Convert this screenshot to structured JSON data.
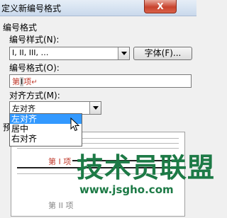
{
  "window": {
    "title": "定义新编号格式",
    "close_glyph": "X"
  },
  "group_label": "编号格式",
  "number_style": {
    "label": "编号样式(N):",
    "value": "I, II, III, …",
    "font_button": "字体(F)..."
  },
  "number_format": {
    "label": "编号格式(O):",
    "prefix": "第",
    "number": "I",
    "suffix": "项",
    "mark": "↵"
  },
  "alignment": {
    "label": "对齐方式(M):",
    "value": "左对齐",
    "options": [
      {
        "label": "左对齐",
        "selected": true
      },
      {
        "label": "居中",
        "selected": false
      },
      {
        "label": "右对齐",
        "selected": false
      }
    ]
  },
  "preview": {
    "label": "预",
    "sample_text": "第 I 项",
    "sample_text_2": "第 II 项"
  },
  "watermark": {
    "text_cn": "技术员联盟",
    "url": "www.jsgho.com"
  },
  "colors": {
    "accent_red": "#c0392b",
    "selection_blue": "#3399ff",
    "watermark_green": "#1d7a46"
  }
}
